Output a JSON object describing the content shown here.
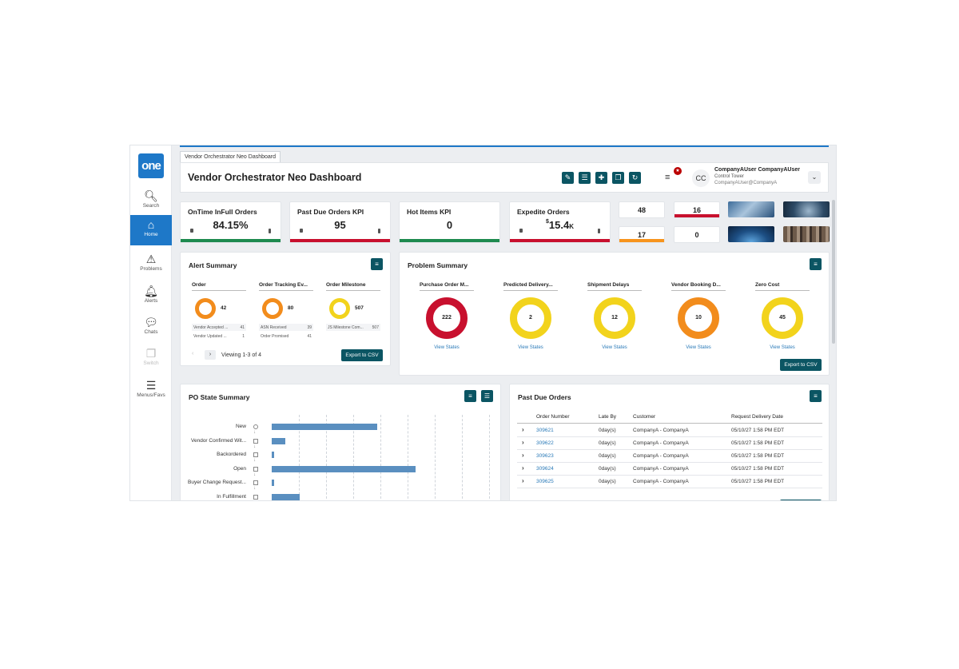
{
  "app": {
    "logo": "one",
    "tab_label": "Vendor Orchestrator Neo Dashboard",
    "page_title": "Vendor Orchestrator Neo Dashboard"
  },
  "sidebar": {
    "items": [
      {
        "label": "Search",
        "icon": "search-icon"
      },
      {
        "label": "Home",
        "icon": "home-icon"
      },
      {
        "label": "Problems",
        "icon": "warning-icon"
      },
      {
        "label": "Alerts",
        "icon": "bell-icon"
      },
      {
        "label": "Chats",
        "icon": "chat-icon"
      },
      {
        "label": "Switch",
        "icon": "switch-icon"
      },
      {
        "label": "Menus/Favs",
        "icon": "menu-icon"
      }
    ]
  },
  "user": {
    "initials": "CC",
    "name": "CompanyAUser CompanyAUser",
    "role": "Control Tower",
    "email": "CompanyAUser@CompanyA"
  },
  "kpis": [
    {
      "title": "OnTime InFull Orders",
      "value": "84.15%",
      "color": "#1e8a4f"
    },
    {
      "title": "Past Due Orders KPI",
      "value": "95",
      "color": "#c8102e"
    },
    {
      "title": "Hot Items KPI",
      "value": "0",
      "color": "#1e8a4f"
    },
    {
      "title": "Expedite Orders",
      "value_prefix": "$",
      "value": "15.4",
      "value_suffix": "K",
      "color": "#c8102e"
    }
  ],
  "mini_kpis": [
    {
      "value": "48",
      "color": ""
    },
    {
      "value": "16",
      "color": "#c8102e"
    },
    {
      "value": "17",
      "color": "#f7941d"
    },
    {
      "value": "0",
      "color": ""
    }
  ],
  "alert_summary": {
    "title": "Alert Summary",
    "columns": [
      {
        "header": "Order",
        "count": "42",
        "color": "#f28c1c",
        "rows": [
          {
            "label": "Vendor Accepted ...",
            "value": "41"
          },
          {
            "label": "Vendor Updated ...",
            "value": "1"
          }
        ]
      },
      {
        "header": "Order Tracking Ev...",
        "count": "80",
        "color": "#f28c1c",
        "rows": [
          {
            "label": "ASN Received",
            "value": "39"
          },
          {
            "label": "Order Promised",
            "value": "41"
          }
        ]
      },
      {
        "header": "Order Milestone",
        "count": "507",
        "color": "#f2d31c",
        "rows": [
          {
            "label": "JS Milestone Com...",
            "value": "507"
          }
        ]
      }
    ],
    "pager_text": "Viewing 1-3 of 4",
    "export_label": "Export to CSV"
  },
  "problem_summary": {
    "title": "Problem Summary",
    "link_label": "View States",
    "export_label": "Export to CSV",
    "items": [
      {
        "header": "Purchase Order M...",
        "value": "222",
        "color": "#c8102e"
      },
      {
        "header": "Predicted Delivery...",
        "value": "2",
        "color": "#f2d31c"
      },
      {
        "header": "Shipment Delays",
        "value": "12",
        "color": "#f2d31c"
      },
      {
        "header": "Vendor Booking D...",
        "value": "10",
        "color": "#f28c1c"
      },
      {
        "header": "Zero Cost",
        "value": "45",
        "color": "#f2d31c"
      }
    ]
  },
  "po_state_summary": {
    "title": "PO State Summary",
    "bar_color": "#5a8fc0",
    "states": [
      {
        "label": "New",
        "value": 38
      },
      {
        "label": "Vendor Confirmed Wit...",
        "value": 5
      },
      {
        "label": "Backordered",
        "value": 1
      },
      {
        "label": "Open",
        "value": 52
      },
      {
        "label": "Buyer Change Request...",
        "value": 1
      },
      {
        "label": "In Fulfillment",
        "value": 10
      }
    ]
  },
  "past_due_orders": {
    "title": "Past Due Orders",
    "columns": [
      "Order Number",
      "Late By",
      "Customer",
      "Request Delivery Date"
    ],
    "rows": [
      {
        "order": "309621",
        "late": "0day(s)",
        "customer": "CompanyA - CompanyA",
        "date": "05/10/27 1:58 PM EDT"
      },
      {
        "order": "309622",
        "late": "0day(s)",
        "customer": "CompanyA - CompanyA",
        "date": "05/10/27 1:58 PM EDT"
      },
      {
        "order": "309623",
        "late": "0day(s)",
        "customer": "CompanyA - CompanyA",
        "date": "05/10/27 1:58 PM EDT"
      },
      {
        "order": "309624",
        "late": "0day(s)",
        "customer": "CompanyA - CompanyA",
        "date": "05/10/27 1:58 PM EDT"
      },
      {
        "order": "309625",
        "late": "0day(s)",
        "customer": "CompanyA - CompanyA",
        "date": "05/10/27 1:58 PM EDT"
      }
    ]
  },
  "toolbar": {
    "buttons": [
      {
        "icon": "edit-icon"
      },
      {
        "icon": "list-icon"
      },
      {
        "icon": "add-icon"
      },
      {
        "icon": "copy-icon"
      },
      {
        "icon": "refresh-icon"
      }
    ]
  }
}
